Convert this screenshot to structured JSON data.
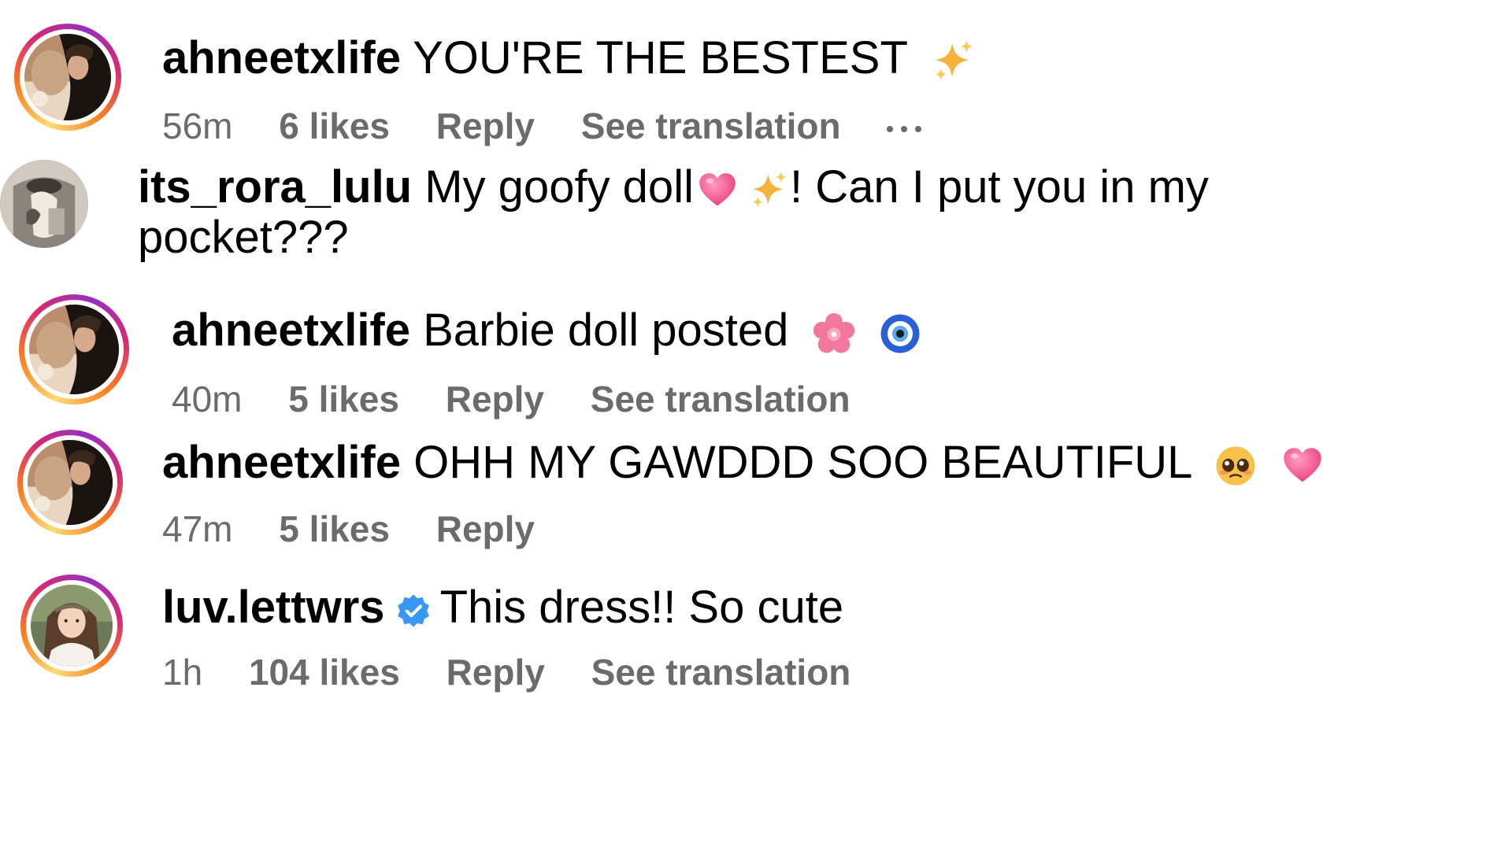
{
  "comments": [
    {
      "username": "ahneetxlife",
      "text": "YOU'RE THE BESTEST",
      "time": "56m",
      "likes": "6 likes",
      "reply": "Reply",
      "translate": "See translation"
    },
    {
      "username": "its_rora_lulu",
      "text_a": "My goofy doll",
      "text_b": "! Can I put you in my",
      "text_c": "pocket???"
    },
    {
      "username": "ahneetxlife",
      "text": "Barbie doll posted",
      "time": "40m",
      "likes": "5 likes",
      "reply": "Reply",
      "translate": "See translation"
    },
    {
      "username": "ahneetxlife",
      "text": "OHH MY GAWDDD SOO BEAUTIFUL",
      "time": "47m",
      "likes": "5 likes",
      "reply": "Reply"
    },
    {
      "username": "luv.lettwrs",
      "text": "This dress!! So cute",
      "time": "1h",
      "likes": "104 likes",
      "reply": "Reply",
      "translate": "See translation"
    }
  ],
  "icons": {
    "sparkles": "sparkles-icon",
    "heart": "pink-heart-icon",
    "flower": "cherry-blossom-icon",
    "evil_eye": "nazar-amulet-icon",
    "pleading": "pleading-face-icon",
    "verified": "verified-badge-icon",
    "more": "more-options-icon"
  },
  "colors": {
    "meta_text": "#6b6b6b",
    "verified_blue": "#3897f0",
    "heart_pink": "#f0578a",
    "sparkle_gold": "#f6b33b"
  }
}
